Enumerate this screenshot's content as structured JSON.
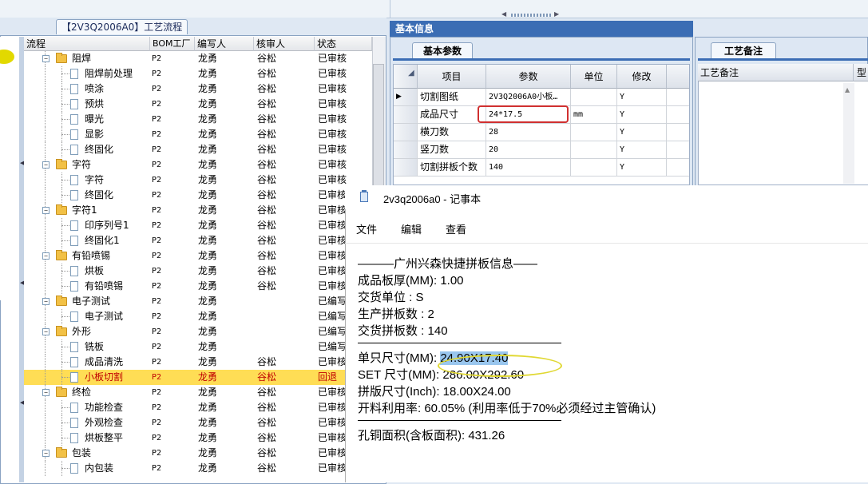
{
  "left_panel": {
    "tab_label": "【2V3Q2006A0】工艺流程",
    "columns": [
      "流程",
      "BOM工厂",
      "编写人",
      "核审人",
      "状态"
    ],
    "rows": [
      {
        "level": 1,
        "type": "folder",
        "name": "阻焊",
        "bom": "P2",
        "writer": "龙勇",
        "reviewer": "谷松",
        "status": "已审核"
      },
      {
        "level": 2,
        "type": "doc",
        "name": "阻焊前处理",
        "bom": "P2",
        "writer": "龙勇",
        "reviewer": "谷松",
        "status": "已审核"
      },
      {
        "level": 2,
        "type": "doc",
        "name": "喷涂",
        "bom": "P2",
        "writer": "龙勇",
        "reviewer": "谷松",
        "status": "已审核"
      },
      {
        "level": 2,
        "type": "doc",
        "name": "预烘",
        "bom": "P2",
        "writer": "龙勇",
        "reviewer": "谷松",
        "status": "已审核"
      },
      {
        "level": 2,
        "type": "doc",
        "name": "曝光",
        "bom": "P2",
        "writer": "龙勇",
        "reviewer": "谷松",
        "status": "已审核"
      },
      {
        "level": 2,
        "type": "doc",
        "name": "显影",
        "bom": "P2",
        "writer": "龙勇",
        "reviewer": "谷松",
        "status": "已审核"
      },
      {
        "level": 2,
        "type": "doc",
        "name": "终固化",
        "bom": "P2",
        "writer": "龙勇",
        "reviewer": "谷松",
        "status": "已审核"
      },
      {
        "level": 1,
        "type": "folder",
        "name": "字符",
        "bom": "P2",
        "writer": "龙勇",
        "reviewer": "谷松",
        "status": "已审核"
      },
      {
        "level": 2,
        "type": "doc",
        "name": "字符",
        "bom": "P2",
        "writer": "龙勇",
        "reviewer": "谷松",
        "status": "已审核"
      },
      {
        "level": 2,
        "type": "doc",
        "name": "终固化",
        "bom": "P2",
        "writer": "龙勇",
        "reviewer": "谷松",
        "status": "已审核"
      },
      {
        "level": 1,
        "type": "folder",
        "name": "字符1",
        "bom": "P2",
        "writer": "龙勇",
        "reviewer": "谷松",
        "status": "已审核"
      },
      {
        "level": 2,
        "type": "doc",
        "name": "印序列号1",
        "bom": "P2",
        "writer": "龙勇",
        "reviewer": "谷松",
        "status": "已审核"
      },
      {
        "level": 2,
        "type": "doc",
        "name": "终固化1",
        "bom": "P2",
        "writer": "龙勇",
        "reviewer": "谷松",
        "status": "已审核"
      },
      {
        "level": 1,
        "type": "folder",
        "name": "有铅喷锡",
        "bom": "P2",
        "writer": "龙勇",
        "reviewer": "谷松",
        "status": "已审核"
      },
      {
        "level": 2,
        "type": "doc",
        "name": "烘板",
        "bom": "P2",
        "writer": "龙勇",
        "reviewer": "谷松",
        "status": "已审核"
      },
      {
        "level": 2,
        "type": "doc",
        "name": "有铅喷锡",
        "bom": "P2",
        "writer": "龙勇",
        "reviewer": "谷松",
        "status": "已审核"
      },
      {
        "level": 1,
        "type": "folder",
        "name": "电子测试",
        "bom": "P2",
        "writer": "龙勇",
        "reviewer": "",
        "status": "已编写"
      },
      {
        "level": 2,
        "type": "doc",
        "name": "电子测试",
        "bom": "P2",
        "writer": "龙勇",
        "reviewer": "",
        "status": "已编写"
      },
      {
        "level": 1,
        "type": "folder",
        "name": "外形",
        "bom": "P2",
        "writer": "龙勇",
        "reviewer": "",
        "status": "已编写"
      },
      {
        "level": 2,
        "type": "doc",
        "name": "铣板",
        "bom": "P2",
        "writer": "龙勇",
        "reviewer": "",
        "status": "已编写"
      },
      {
        "level": 2,
        "type": "doc",
        "name": "成品清洗",
        "bom": "P2",
        "writer": "龙勇",
        "reviewer": "谷松",
        "status": "已审核"
      },
      {
        "level": 2,
        "type": "doc",
        "name": "小板切割",
        "bom": "P2",
        "writer": "龙勇",
        "reviewer": "谷松",
        "status": "回退",
        "selected": true
      },
      {
        "level": 1,
        "type": "folder",
        "name": "终检",
        "bom": "P2",
        "writer": "龙勇",
        "reviewer": "谷松",
        "status": "已审核"
      },
      {
        "level": 2,
        "type": "doc",
        "name": "功能检查",
        "bom": "P2",
        "writer": "龙勇",
        "reviewer": "谷松",
        "status": "已审核"
      },
      {
        "level": 2,
        "type": "doc",
        "name": "外观检查",
        "bom": "P2",
        "writer": "龙勇",
        "reviewer": "谷松",
        "status": "已审核"
      },
      {
        "level": 2,
        "type": "doc",
        "name": "烘板整平",
        "bom": "P2",
        "writer": "龙勇",
        "reviewer": "谷松",
        "status": "已审核"
      },
      {
        "level": 1,
        "type": "folder",
        "name": "包装",
        "bom": "P2",
        "writer": "龙勇",
        "reviewer": "谷松",
        "status": "已审核"
      },
      {
        "level": 2,
        "type": "doc",
        "name": "内包装",
        "bom": "P2",
        "writer": "龙勇",
        "reviewer": "谷松",
        "status": "已审核"
      }
    ]
  },
  "info_panel": {
    "title": "基本信息",
    "tab_label": "基本参数",
    "columns": [
      "项目",
      "参数",
      "单位",
      "修改"
    ],
    "rows": [
      {
        "item": "切割图纸",
        "param": "2V3Q2006A0小板…",
        "unit": "",
        "modify": "Y",
        "current": true
      },
      {
        "item": "成品尺寸",
        "param": "24*17.5",
        "unit": "mm",
        "modify": "Y"
      },
      {
        "item": "横刀数",
        "param": "28",
        "unit": "",
        "modify": "Y"
      },
      {
        "item": "竖刀数",
        "param": "20",
        "unit": "",
        "modify": "Y"
      },
      {
        "item": "切割拼板个数",
        "param": "140",
        "unit": "",
        "modify": "Y"
      }
    ]
  },
  "notes_panel": {
    "tab_label": "工艺备注",
    "column": "工艺备注",
    "column2": "型"
  },
  "notepad": {
    "title": "2v3q2006a0 - 记事本",
    "menu": [
      "文件",
      "编辑",
      "查看"
    ],
    "header_line": "———广州兴森快捷拼板信息——",
    "block1": [
      "成品板厚(MM): 1.00",
      "交货单位 : S",
      "生产拼板数 : 2",
      "交货拼板数 : 140"
    ],
    "unit_size_label": "单只尺寸(MM): ",
    "unit_size_value": "24.90X17.40",
    "block2": [
      "SET 尺寸(MM): 286.00X292.60",
      "拼版尺寸(Inch): 18.00X24.00",
      "开料利用率: 60.05% (利用率低于70%必须经过主管确认)"
    ],
    "block3": [
      "孔铜面积(含板面积): 431.26"
    ]
  }
}
